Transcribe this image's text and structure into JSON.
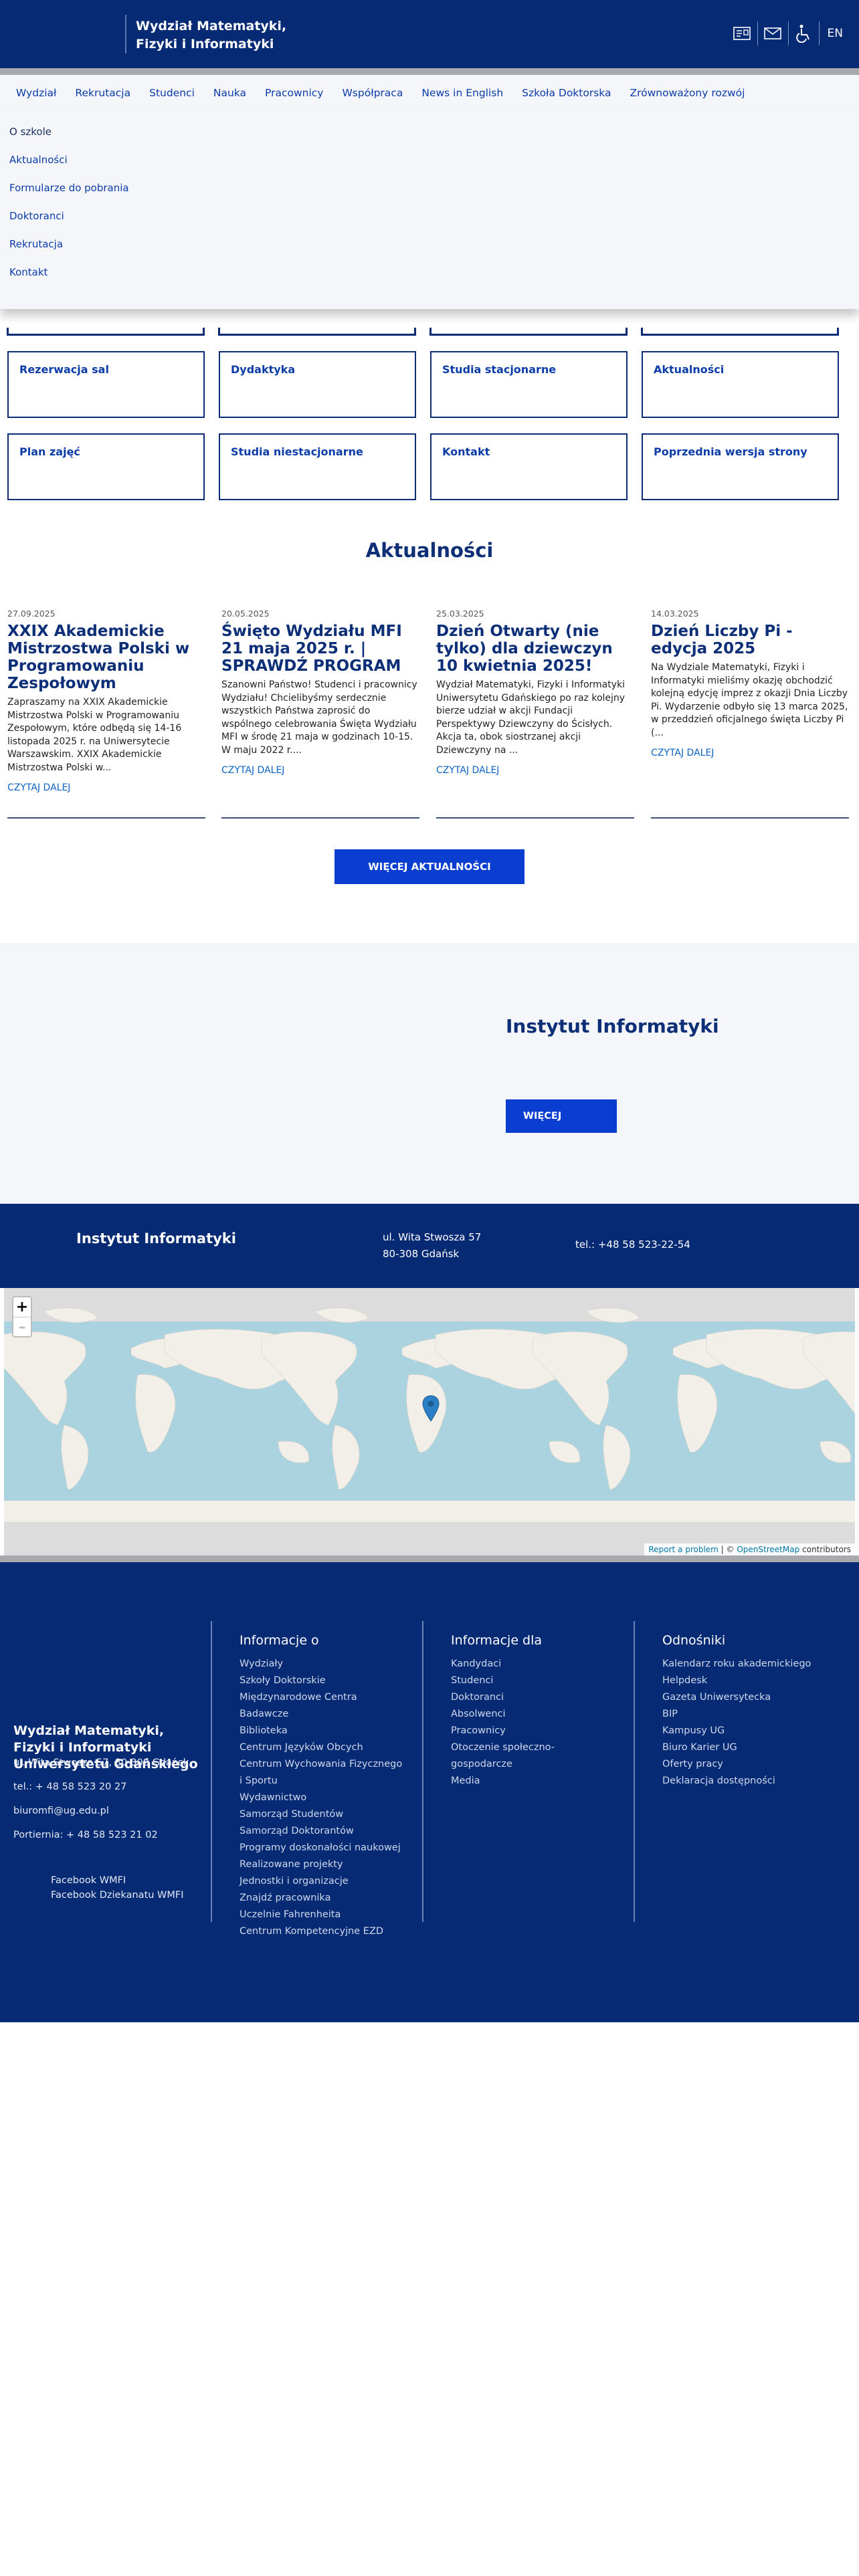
{
  "header": {
    "title_line1": "Wydział Matematyki,",
    "title_line2": "Fizyki i Informatyki",
    "lang": "EN",
    "icons": [
      "map-icon",
      "mail-icon",
      "accessibility-icon"
    ]
  },
  "nav": {
    "items": [
      "Wydział",
      "Rekrutacja",
      "Studenci",
      "Nauka",
      "Pracownicy",
      "Współpraca",
      "News in English",
      "Szkoła Doktorska",
      "Zrównoważony rozwój"
    ]
  },
  "dropdown": {
    "items": [
      "O szkole",
      "Aktualności",
      "Formularze do pobrania",
      "Doktoranci",
      "Rekrutacja",
      "Kontakt"
    ]
  },
  "tiles": {
    "row1": [
      "Rezerwacja sal",
      "Dydaktyka",
      "Studia stacjonarne",
      "Aktualności"
    ],
    "row2": [
      "Plan zajęć",
      "Studia niestacjonarne",
      "Kontakt",
      "Poprzednia wersja strony"
    ]
  },
  "news_section": {
    "title": "Aktualności",
    "read_more": "CZYTAJ DALEJ",
    "more_button": "WIĘCEJ AKTUALNOŚCI",
    "items": [
      {
        "date": "27.09.2025",
        "title": "XXIX Akademickie Mistrzostwa Polski w Programowaniu Zespołowym",
        "text": "Zapraszamy na XXIX Akademickie Mistrzostwa Polski w Programowaniu Zespołowym, które odbędą się 14-16 listopada 2025 r. na Uniwersytecie Warszawskim.   XXIX Akademickie Mistrzostwa Polski w..."
      },
      {
        "date": "20.05.2025",
        "title": "Święto Wydziału MFI 21 maja 2025 r. | SPRAWDŹ PROGRAM",
        "text": "Szanowni Państwo! Studenci i pracownicy Wydziału!   Chcielibyśmy serdecznie wszystkich Państwa zaprosić do wspólnego celebrowania Święta Wydziału MFI w środę 21 maja w godzinach 10-15. W maju 2022 r...."
      },
      {
        "date": "25.03.2025",
        "title": "Dzień Otwarty (nie tylko) dla dziewczyn 10 kwietnia 2025!",
        "text": "Wydział Matematyki, Fizyki i Informatyki Uniwersytetu Gdańskiego po raz kolejny bierze udział w akcji Fundacji Perspektywy Dziewczyny do Ścisłych. Akcja ta, obok siostrzanej akcji Dziewczyny na ..."
      },
      {
        "date": "14.03.2025",
        "title": "Dzień Liczby Pi - edycja 2025",
        "text": "Na Wydziale Matematyki, Fizyki i Informatyki mieliśmy okazję obchodzić kolejną edycję imprez z okazji Dnia Liczby Pi. Wydarzenie odbyło się 13 marca 2025, w przeddzień oficjalnego święta Liczby Pi (..."
      }
    ]
  },
  "institute": {
    "title": "Instytut Informatyki",
    "button": "WIĘCEJ"
  },
  "contact_bar": {
    "name": "Instytut Informatyki",
    "address_line1": "ul. Wita Stwosza 57",
    "address_line2": "80-308 Gdańsk",
    "phone": "tel.: +48 58 523-22-54"
  },
  "map": {
    "zoom_in": "+",
    "zoom_out": "–",
    "report": "Report a problem",
    "sep": " | © ",
    "osm": "OpenStreetMap",
    "contributors": " contributors",
    "colors": {
      "ocean": "#aad3df",
      "land": "#f2efe9",
      "marker": "#2b7fc4"
    }
  },
  "footer": {
    "name": "Wydział Matematyki, Fizyki i Informatyki Uniwersytetu Gdańskiego",
    "address": "ul. Wita Stwosza 57, 80-308 Gdańsk",
    "tel": "tel.: + 48 58 523 20 27",
    "email": "biuromfi@ug.edu.pl",
    "porter": "Portiernia: + 48 58 523 21 02",
    "social": [
      "Facebook WMFI",
      "Facebook Dziekanatu WMFI"
    ],
    "columns": [
      {
        "title": "Informacje o",
        "items": [
          "Wydziały",
          "Szkoły Doktorskie",
          "Międzynarodowe Centra Badawcze",
          "Biblioteka",
          "Centrum Języków Obcych",
          "Centrum Wychowania Fizycznego i Sportu",
          "Wydawnictwo",
          "Samorząd Studentów",
          "Samorząd Doktorantów",
          "Programy doskonałości naukowej",
          "Realizowane projekty",
          "Jednostki i organizacje",
          "Znajdź pracownika",
          "Uczelnie Fahrenheita",
          "Centrum Kompetencyjne EZD"
        ]
      },
      {
        "title": "Informacje dla",
        "items": [
          "Kandydaci",
          "Studenci",
          "Doktoranci",
          "Absolwenci",
          "Pracownicy",
          "Otoczenie społeczno-gospodarcze",
          "Media"
        ]
      },
      {
        "title": "Odnośniki",
        "items": [
          "Kalendarz roku akademickiego",
          "Helpdesk",
          "Gazeta Uniwersytecka",
          "BIP",
          "Kampusy UG",
          "Biuro Karier UG",
          "Oferty pracy",
          "Deklaracja dostępności"
        ]
      }
    ]
  }
}
